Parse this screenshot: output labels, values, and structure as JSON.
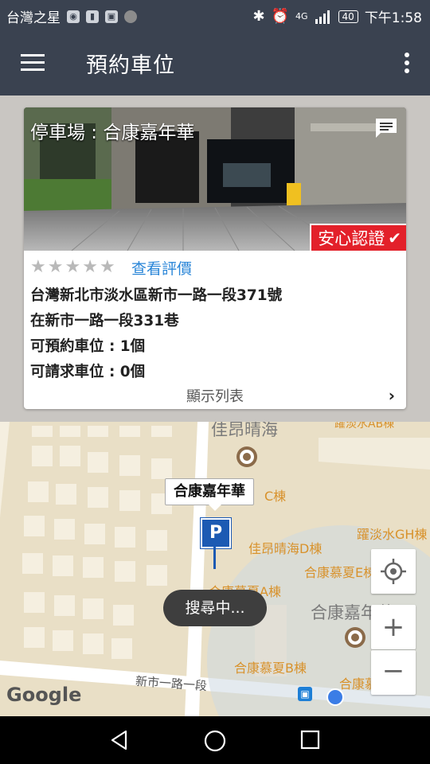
{
  "status_bar": {
    "carrier": "台灣之星",
    "network": "4G",
    "battery": "40",
    "time": "下午1:58",
    "icons": [
      "location-icon",
      "trash-icon",
      "gallery-icon",
      "avatar-icon",
      "bluetooth-icon",
      "alarm-icon",
      "signal-icon",
      "battery-icon"
    ]
  },
  "app_bar": {
    "title": "預約車位",
    "menu_icon": "hamburger-menu-icon",
    "overflow_icon": "more-vert-icon"
  },
  "card": {
    "photo_title": "停車場 : 合康嘉年華",
    "badge_text": "安心認證",
    "rating_stars": 0,
    "rating_max": 5,
    "review_link": "查看評價",
    "address_line1": "台灣新北市淡水區新市一路一段371號",
    "address_line2": "在新市一路一段331巷",
    "reservable": "可預約車位 : 1個",
    "requestable": "可請求車位 : 0個",
    "list_link": "顯示列表",
    "colors": {
      "badge": "#e3202a",
      "link": "#2a86d8"
    }
  },
  "map": {
    "labels": {
      "jiaang_big": "佳昂晴海",
      "jiaang_d": "佳昂晴海D棟",
      "yaodanshui_ab": "躍淡水AB棟",
      "yaodanshui_gh": "躍淡水GH棟",
      "hekang_mu_e": "合康慕夏E棟",
      "hekang_mu_a": "合康慕夏A棟",
      "hekang_mu_b": "合康慕夏B棟",
      "hekang_mu_c": "合康慕夏C棟",
      "hekang_big": "合康嘉年華",
      "c_bldg_fragment": "C棟",
      "road": "新市一路一段"
    },
    "callout": "合康嘉年華",
    "marker_letter": "P",
    "toast": "搜尋中...",
    "google_logo": "Google",
    "colors": {
      "marker": "#1c5ab3",
      "land": "#e9dfc6",
      "road": "#ffffff"
    }
  },
  "nav_bar": {
    "icons": [
      "back-icon",
      "home-icon",
      "recents-icon"
    ]
  }
}
